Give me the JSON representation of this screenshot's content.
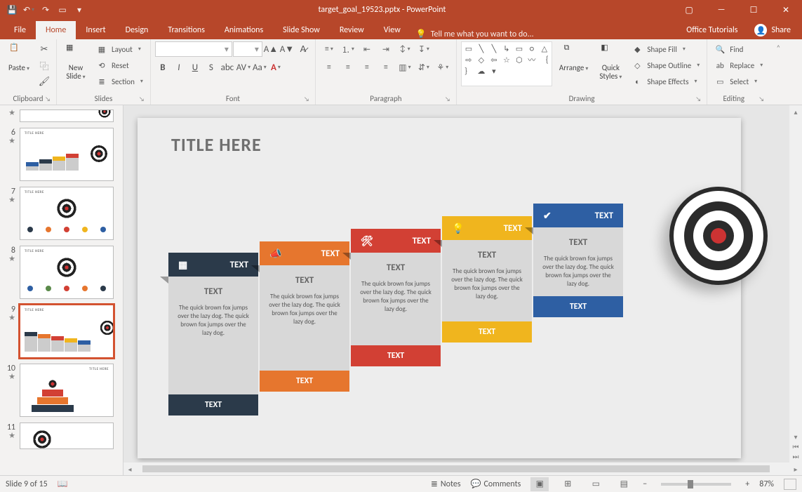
{
  "app": {
    "filename": "target_goal_19523.pptx",
    "suffix": " - PowerPoint"
  },
  "qat": {
    "save": "Save",
    "undo": "Undo",
    "redo": "Redo",
    "startfrombeg": "Start From Beginning",
    "more": "Customize"
  },
  "tabs": {
    "file": "File",
    "home": "Home",
    "insert": "Insert",
    "design": "Design",
    "transitions": "Transitions",
    "animations": "Animations",
    "slideshow": "Slide Show",
    "review": "Review",
    "view": "View",
    "tellme": "Tell me what you want to do...",
    "tutorials": "Office Tutorials",
    "share": "Share"
  },
  "ribbon": {
    "clipboard": {
      "label": "Clipboard",
      "paste": "Paste",
      "cut": "Cut",
      "copy": "Copy",
      "format_painter": "Format Painter"
    },
    "slides": {
      "label": "Slides",
      "new_slide": "New\nSlide",
      "layout": "Layout",
      "reset": "Reset",
      "section": "Section"
    },
    "font": {
      "label": "Font"
    },
    "paragraph": {
      "label": "Paragraph"
    },
    "drawing": {
      "label": "Drawing",
      "arrange": "Arrange",
      "quick_styles": "Quick\nStyles",
      "shape_fill": "Shape Fill",
      "shape_outline": "Shape Outline",
      "shape_effects": "Shape Effects"
    },
    "editing": {
      "label": "Editing",
      "find": "Find",
      "replace": "Replace",
      "select": "Select"
    }
  },
  "thumbs": [
    {
      "n": "6",
      "label": "TITLE HERE"
    },
    {
      "n": "7",
      "label": "TITLE HERE"
    },
    {
      "n": "8",
      "label": "TITLE HERE"
    },
    {
      "n": "9",
      "label": "TITLE HERE"
    },
    {
      "n": "10",
      "label": "TITLE HERE"
    },
    {
      "n": "11",
      "label": ""
    }
  ],
  "slide": {
    "title": "TITLE HERE",
    "steps": [
      {
        "top": "TEXT",
        "body_title": "TEXT",
        "body": "The quick brown fox jumps over the lazy dog. The quick brown fox jumps over the lazy dog.",
        "foot": "TEXT"
      },
      {
        "top": "TEXT",
        "body_title": "TEXT",
        "body": "The quick brown fox jumps over the lazy dog. The quick brown fox jumps over the lazy dog.",
        "foot": "TEXT"
      },
      {
        "top": "TEXT",
        "body_title": "TEXT",
        "body": "The quick brown fox jumps over the lazy dog. The quick brown fox jumps over the lazy dog.",
        "foot": "TEXT"
      },
      {
        "top": "TEXT",
        "body_title": "TEXT",
        "body": "The quick brown fox jumps over the lazy dog. The quick brown fox jumps over the lazy dog.",
        "foot": "TEXT"
      },
      {
        "top": "TEXT",
        "body_title": "TEXT",
        "body": "The quick brown fox jumps over the lazy dog. The quick brown fox jumps over the lazy dog.",
        "foot": "TEXT"
      }
    ]
  },
  "status": {
    "slide": "Slide 9 of 15",
    "notes": "Notes",
    "comments": "Comments",
    "zoom": "87%",
    "minus": "−",
    "plus": "+"
  }
}
